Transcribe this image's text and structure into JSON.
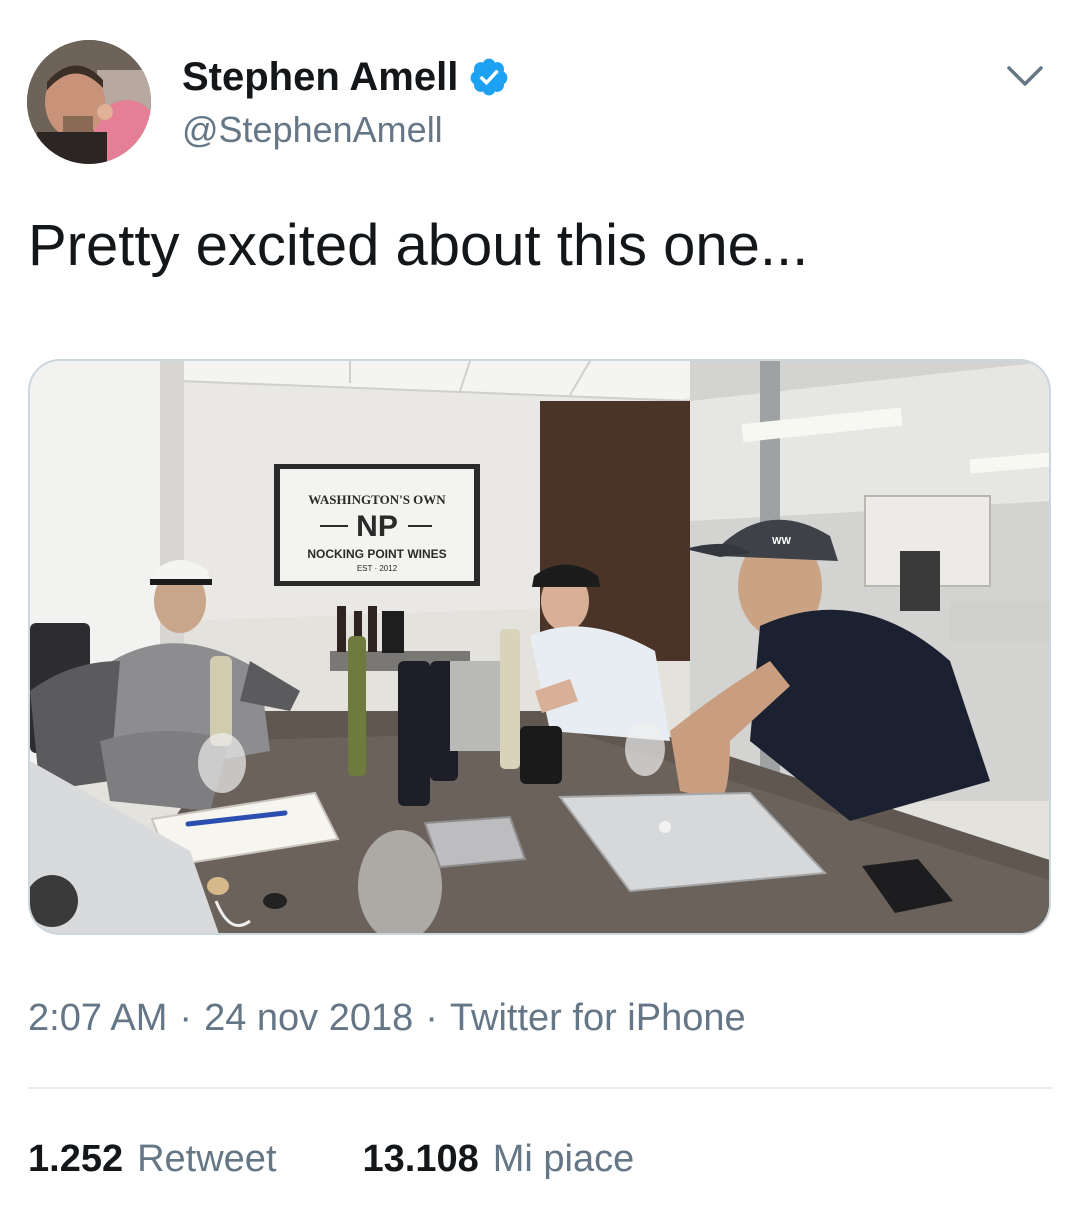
{
  "tweet": {
    "author_name": "Stephen Amell",
    "handle": "@StephenAmell",
    "text": "Pretty excited about this one...",
    "time": "2:07 AM",
    "date": "24 nov 2018",
    "source": "Twitter for iPhone",
    "separator": "·"
  },
  "stats": {
    "retweets_count": "1.252",
    "retweets_label": "Retweet",
    "likes_count": "13.108",
    "likes_label": "Mi piace"
  },
  "media": {
    "screen_arc_text": "WASHINGTON'S OWN",
    "screen_logo": "NP",
    "screen_brand": "NOCKING POINT WINES",
    "screen_est": "EST · 2012",
    "cap_text": "WW"
  },
  "icons": {
    "verified": "verified-badge-icon",
    "menu": "chevron-down-icon"
  },
  "colors": {
    "verified_blue": "#1da1f2",
    "secondary_text": "#657786",
    "primary_text": "#14171a"
  }
}
